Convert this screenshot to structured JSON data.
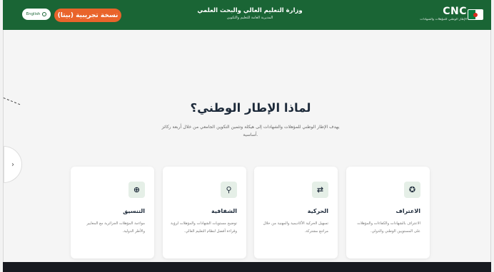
{
  "header": {
    "lang_label": "English",
    "beta_label": "نسخة تجريبية (بيتا)",
    "ministry_title": "وزارة التعليم العالي والبحث العلمي",
    "ministry_subtitle": "المديرية العامة للتعليم والتكوين",
    "brand_name": "CNC",
    "brand_subtitle": "الإطار الوطني للمؤهلات والشهادات"
  },
  "main": {
    "title": "لماذا الإطار الوطني؟",
    "description": "يهدف الإطار الوطني للمؤهلات والشهادات إلى هيكلة وتثمين التكوين الجامعي من خلال أربعة ركائز أساسية.",
    "nav_icon": "chevron-right-icon"
  },
  "cards": [
    {
      "icon": "award-icon",
      "icon_glyph": "✪",
      "title": "الاعتراف",
      "desc": "الاعتراف بالشهادات والكفاءات والمؤهلات على المستويين الوطني والدولي."
    },
    {
      "icon": "arrows-icon",
      "icon_glyph": "⇄",
      "title": "الحركية",
      "desc": "تسهيل الحركية الأكاديمية والمهنية من خلال مراجع مشتركة."
    },
    {
      "icon": "search-icon",
      "icon_glyph": "⚲",
      "title": "الشفافية",
      "desc": "توضيح مستويات الشهادات والمؤهلات لرؤية وقراءة أفضل لنظام التعليم العالي."
    },
    {
      "icon": "globe-icon",
      "icon_glyph": "⊕",
      "title": "التنسيق",
      "desc": "مواءمة المؤهلات الجزائرية مع المعايير والأطر الدولية."
    }
  ]
}
